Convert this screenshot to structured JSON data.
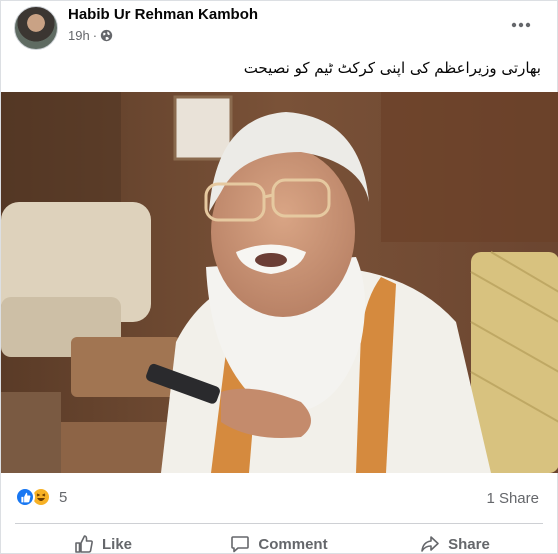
{
  "post": {
    "author": "Habib Ur Rehman Kamboh",
    "time": "19h",
    "audience_icon": "globe-icon",
    "caption": "بھارتی وزیراعظم کی اپنی کرکٹ ٹیم کو نصیحت",
    "more_icon": "more-options-icon"
  },
  "stats": {
    "reaction_icons": [
      "like-icon",
      "haha-icon"
    ],
    "reaction_count": "5",
    "shares": "1 Share"
  },
  "actions": {
    "like": "Like",
    "comment": "Comment",
    "share": "Share"
  },
  "colors": {
    "text_primary": "#050505",
    "text_secondary": "#65676b",
    "like_blue": "#1877f2",
    "haha_yellow": "#f7b125"
  }
}
